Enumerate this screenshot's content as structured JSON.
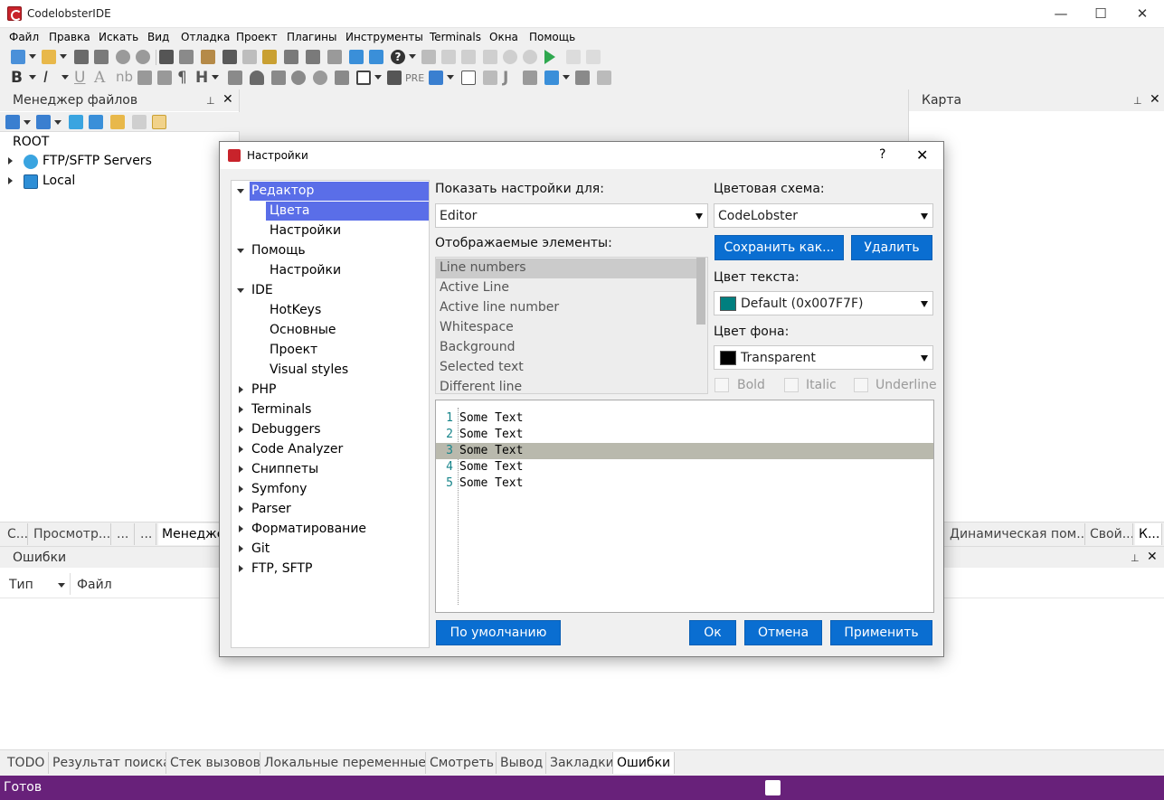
{
  "window": {
    "title": "CodelobsterIDE",
    "controls": [
      "—",
      "☐",
      "✕"
    ]
  },
  "menu": [
    "Файл",
    "Правка",
    "Искать",
    "Вид",
    "Отладка",
    "Проект",
    "Плагины",
    "Инструменты",
    "Terminals",
    "Окна",
    "Помощь"
  ],
  "toolbar_text_glyphs": {
    "bold": "B",
    "italic": "I",
    "underline": "U",
    "font": "A",
    "nb": "nb",
    "h": "H",
    "pilcrow": "¶",
    "pre": "PRE",
    "j": "J",
    "help": "?"
  },
  "file_manager": {
    "title": "Менеджер файлов",
    "pin": "📌",
    "close": "✕",
    "root": "ROOT",
    "nodes": [
      "FTP/SFTP Servers",
      "Local"
    ]
  },
  "map_panel": {
    "title": "Карта"
  },
  "left_tabs": [
    "С...",
    "Просмотр...",
    "...",
    "...",
    "Менедже"
  ],
  "right_tabs": [
    "Динамическая пом...",
    "Свой...",
    "К..."
  ],
  "errors_panel": {
    "title": "Ошибки",
    "columns": [
      "Тип",
      "Файл"
    ]
  },
  "bottom_tabs": [
    "TODO",
    "Результат поиска",
    "Стек вызовов",
    "Локальные переменные",
    "Смотреть",
    "Вывод",
    "Закладки",
    "Ошибки"
  ],
  "status": {
    "text": "Готов"
  },
  "dialog": {
    "title": "Настройки",
    "help": "?",
    "close": "✕",
    "tree": [
      {
        "label": "Редактор",
        "level": 0,
        "state": "open",
        "selected": true
      },
      {
        "label": "Цвета",
        "level": 1,
        "state": "leaf",
        "selected": true
      },
      {
        "label": "Настройки",
        "level": 1,
        "state": "leaf"
      },
      {
        "label": "Помощь",
        "level": 0,
        "state": "open"
      },
      {
        "label": "Настройки",
        "level": 1,
        "state": "leaf"
      },
      {
        "label": "IDE",
        "level": 0,
        "state": "open"
      },
      {
        "label": "HotKeys",
        "level": 1,
        "state": "leaf"
      },
      {
        "label": "Основные",
        "level": 1,
        "state": "leaf"
      },
      {
        "label": "Проект",
        "level": 1,
        "state": "leaf"
      },
      {
        "label": "Visual styles",
        "level": 1,
        "state": "leaf"
      },
      {
        "label": "PHP",
        "level": 0,
        "state": "closed"
      },
      {
        "label": "Terminals",
        "level": 0,
        "state": "closed"
      },
      {
        "label": "Debuggers",
        "level": 0,
        "state": "closed"
      },
      {
        "label": "Code Analyzer",
        "level": 0,
        "state": "closed"
      },
      {
        "label": "Сниппеты",
        "level": 0,
        "state": "closed"
      },
      {
        "label": "Symfony",
        "level": 0,
        "state": "closed"
      },
      {
        "label": "Parser",
        "level": 0,
        "state": "closed"
      },
      {
        "label": "Форматирование",
        "level": 0,
        "state": "closed"
      },
      {
        "label": "Git",
        "level": 0,
        "state": "closed"
      },
      {
        "label": "FTP, SFTP",
        "level": 0,
        "state": "closed"
      }
    ],
    "show_for_label": "Показать настройки для:",
    "show_for_value": "Editor",
    "scheme_label": "Цветовая схема:",
    "scheme_value": "CodeLobster",
    "save_as": "Сохранить как...",
    "delete": "Удалить",
    "elements_label": "Отображаемые элементы:",
    "elements": [
      "Line numbers",
      "Active Line",
      "Active line number",
      "Whitespace",
      "Background",
      "Selected text",
      "Different line"
    ],
    "text_color_label": "Цвет текста:",
    "text_color_value": "Default (0x007F7F)",
    "text_color_hex": "#007F7F",
    "bg_color_label": "Цвет фона:",
    "bg_color_value": "Transparent",
    "bg_color_hex": "#000000",
    "bold": "Bold",
    "italic": "Italic",
    "underline": "Underline",
    "preview": [
      {
        "num": "1",
        "text": "Some Text"
      },
      {
        "num": "2",
        "text": "Some Text"
      },
      {
        "num": "3",
        "text": "Some Text",
        "highlight": true
      },
      {
        "num": "4",
        "text": "Some Text"
      },
      {
        "num": "5",
        "text": "Some Text"
      }
    ],
    "default_btn": "По умолчанию",
    "ok": "Ок",
    "cancel": "Отмена",
    "apply": "Применить"
  },
  "colors": {
    "accent": "#0a6ed1",
    "status_bar": "#68217a",
    "tree_selection": "#5a6ee8"
  }
}
